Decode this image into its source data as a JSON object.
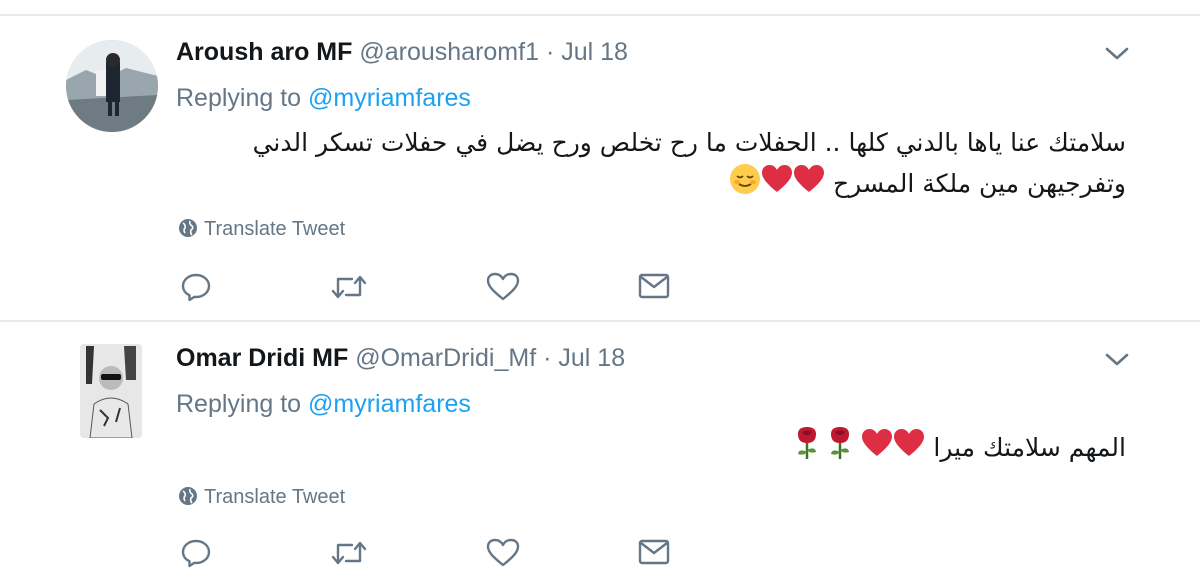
{
  "tweets": [
    {
      "name": "Aroush aro MF",
      "handle": "@arousharomf1",
      "separator": "·",
      "date": "Jul 18",
      "replying_prefix": "Replying to",
      "replying_to": "@myriamfares",
      "text_line1": "سلامتك عنا ياها بالدني كلها .. الحفلات ما رح تخلص ورح يضل في حفلات تسكر الدني",
      "text_line2": "وتفرجيهن مين ملكة المسرح",
      "emojis": [
        "red-heart",
        "red-heart",
        "relieved-face"
      ],
      "translate_label": "Translate Tweet"
    },
    {
      "name": "Omar Dridi MF",
      "handle": "@OmarDridi_Mf",
      "separator": "·",
      "date": "Jul 18",
      "replying_prefix": "Replying to",
      "replying_to": "@myriamfares",
      "text_line1": "المهم سلامتك ميرا",
      "emojis": [
        "red-heart",
        "red-heart",
        "rose",
        "rose"
      ],
      "translate_label": "Translate Tweet"
    }
  ],
  "colors": {
    "link": "#1da1f2",
    "secondary": "#657786",
    "divider": "#e6ecf0",
    "heart": "#dd2e44"
  }
}
